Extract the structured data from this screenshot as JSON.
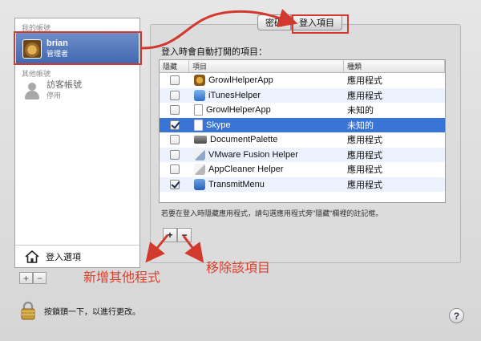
{
  "sidebar": {
    "my_account_header": "我的帳號",
    "other_accounts_header": "其他帳號",
    "users": [
      {
        "name": "brian",
        "role": "管理者",
        "avatar": "lion-avatar-icon"
      },
      {
        "name": "訪客帳號",
        "role": "停用",
        "avatar": "guest-avatar-icon"
      }
    ],
    "login_options_label": "登入選項",
    "add_label": "+",
    "remove_label": "−"
  },
  "tabs": [
    {
      "label": "密碼",
      "selected": false
    },
    {
      "label": "登入項目",
      "selected": true
    }
  ],
  "panel_label": "登入時會自動打開的項目：",
  "table": {
    "headers": {
      "hide": "隱藏",
      "item": "項目",
      "kind": "種類"
    },
    "rows": [
      {
        "checked": false,
        "name": "GrowlHelperApp",
        "kind": "應用程式",
        "icon": "growl-icon"
      },
      {
        "checked": false,
        "name": "iTunesHelper",
        "kind": "應用程式",
        "icon": "itunes-icon"
      },
      {
        "checked": false,
        "name": "GrowlHelperApp",
        "kind": "未知的",
        "icon": "document-icon"
      },
      {
        "checked": true,
        "name": "Skype",
        "kind": "未知的",
        "icon": "document-icon",
        "selected": true
      },
      {
        "checked": false,
        "name": "DocumentPalette",
        "kind": "應用程式",
        "icon": "palette-icon"
      },
      {
        "checked": false,
        "name": "VMware Fusion Helper",
        "kind": "應用程式",
        "icon": "vmware-icon"
      },
      {
        "checked": false,
        "name": "AppCleaner Helper",
        "kind": "應用程式",
        "icon": "appcleaner-icon"
      },
      {
        "checked": true,
        "name": "TransmitMenu",
        "kind": "應用程式",
        "icon": "transmit-icon"
      }
    ]
  },
  "note": "若要在登入時隱藏應用程式，請勾選應用程式旁\"隱藏\"欄裡的註記框。",
  "table_buttons": {
    "add": "+",
    "remove": "−"
  },
  "lock_text": "按鎖頭一下，以進行更改。",
  "help_label": "?",
  "annotations": {
    "add_other": "新增其他程式",
    "remove_item": "移除該項目"
  },
  "colors": {
    "annotation_red": "#d33a2e",
    "selection_blue": "#3875d7"
  }
}
